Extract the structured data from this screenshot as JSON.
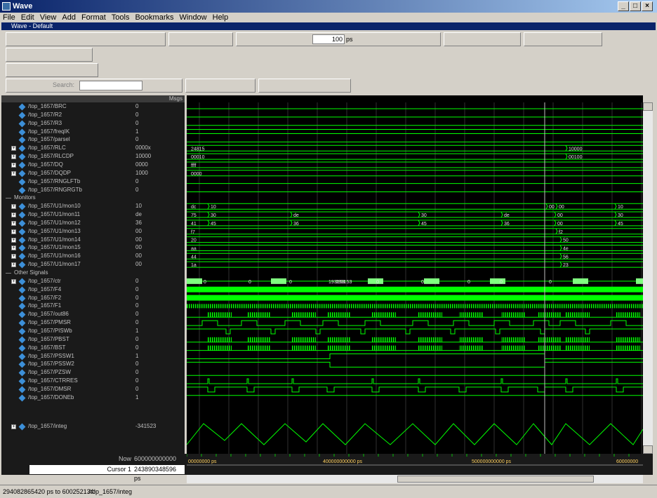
{
  "window": {
    "title": "Wave",
    "subtitle": "Wave - Default"
  },
  "menu": [
    "File",
    "Edit",
    "View",
    "Add",
    "Format",
    "Tools",
    "Bookmarks",
    "Window",
    "Help"
  ],
  "toolbar": {
    "time_value": "100",
    "time_unit": "ps",
    "search_placeholder": "Search:"
  },
  "columns": {
    "names_header": "",
    "values_header": "Msgs"
  },
  "signals": [
    {
      "name": "/top_1657/BRC",
      "value": "0",
      "expand": false
    },
    {
      "name": "/top_1657/R2",
      "value": "0",
      "expand": false
    },
    {
      "name": "/top_1657/R3",
      "value": "0",
      "expand": false
    },
    {
      "name": "/top_1657/freqIK",
      "value": "1",
      "expand": false
    },
    {
      "name": "/top_1657/parsel",
      "value": "0",
      "expand": false
    },
    {
      "name": "/top_1657/RLC",
      "value": "0000x",
      "expand": true
    },
    {
      "name": "/top_1657/RLCDP",
      "value": "10000",
      "expand": true
    },
    {
      "name": "/top_1657/DQ",
      "value": "0000",
      "expand": true
    },
    {
      "name": "/top_1657/DQDP",
      "value": "1000",
      "expand": true
    },
    {
      "name": "/top_1657/RNGLFTb",
      "value": "0",
      "expand": false
    },
    {
      "name": "/top_1657/RNGRGTb",
      "value": "0",
      "expand": false
    },
    {
      "name": "Monitors",
      "value": "",
      "divider": true
    },
    {
      "name": "/top_1657/U1/mon10",
      "value": "10",
      "expand": true
    },
    {
      "name": "/top_1657/U1/mon11",
      "value": "de",
      "expand": true
    },
    {
      "name": "/top_1657/U1/mon12",
      "value": "36",
      "expand": true
    },
    {
      "name": "/top_1657/U1/mon13",
      "value": "00",
      "expand": true
    },
    {
      "name": "/top_1657/U1/mon14",
      "value": "00",
      "expand": true
    },
    {
      "name": "/top_1657/U1/mon15",
      "value": "00",
      "expand": true
    },
    {
      "name": "/top_1657/U1/mon16",
      "value": "00",
      "expand": true
    },
    {
      "name": "/top_1657/U1/mon17",
      "value": "00",
      "expand": true
    },
    {
      "name": "Other Signals",
      "value": "",
      "divider": true
    },
    {
      "name": "/top_1657/ctr",
      "value": "0",
      "expand": true
    },
    {
      "name": "/top_1657/F4",
      "value": "0",
      "expand": false
    },
    {
      "name": "/top_1657/F2",
      "value": "0",
      "expand": false
    },
    {
      "name": "/top_1657/F1",
      "value": "0",
      "expand": false
    },
    {
      "name": "/top_1657/out86",
      "value": "0",
      "expand": false
    },
    {
      "name": "/top_1657/PMSR",
      "value": "0",
      "expand": false
    },
    {
      "name": "/top_1657/PISWb",
      "value": "1",
      "expand": false
    },
    {
      "name": "/top_1657/PBST",
      "value": "0",
      "expand": false
    },
    {
      "name": "/top_1657/BST",
      "value": "0",
      "expand": false
    },
    {
      "name": "/top_1657/PSSW1",
      "value": "1",
      "expand": false
    },
    {
      "name": "/top_1657/PSSW2",
      "value": "0",
      "expand": false
    },
    {
      "name": "/top_1657/PZSW",
      "value": "0",
      "expand": false
    },
    {
      "name": "/top_1657/CTRRES",
      "value": "0",
      "expand": false
    },
    {
      "name": "/top_1657/DMSR",
      "value": "0",
      "expand": false
    },
    {
      "name": "/top_1657/DONEb",
      "value": "1",
      "expand": false
    }
  ],
  "integ": {
    "name": "/top_1657/integ",
    "value": "-341523"
  },
  "bus_labels": {
    "rlc": [
      "24815",
      "10000"
    ],
    "rlcdp": [
      "00010",
      "00100"
    ],
    "dq": [
      "ffff"
    ],
    "dqdp": [
      "0000"
    ],
    "mon10": [
      "dc",
      "10",
      "00",
      "00",
      "10"
    ],
    "mon11": [
      "75",
      "30",
      "de",
      "30",
      "de",
      "00",
      "30"
    ],
    "mon12": [
      "41",
      "45",
      "36",
      "45",
      "36",
      "00",
      "45"
    ],
    "mon13": [
      "f7",
      "f2"
    ],
    "mon14": [
      "20",
      "50"
    ],
    "mon15": [
      "aa",
      "4e"
    ],
    "mon16": [
      "44",
      "56"
    ],
    "mon17": [
      "1a",
      "23"
    ],
    "ctr": [
      "0",
      "0",
      "0",
      "193153",
      "0",
      "0",
      "0",
      "0",
      "0",
      "0"
    ]
  },
  "bottom": {
    "now_label": "Now",
    "now_value": "600000000000 ps",
    "cursor_label": "Cursor 1",
    "cursor_value": "243890348596 ps",
    "ticks": [
      "00000000 ps",
      "400000000000 ps",
      "500000000000 ps",
      "60000000"
    ]
  },
  "status": {
    "range": "294082865420 ps to 600252134!",
    "selected": "/top_1657/integ"
  },
  "colors": {
    "wave": "#00ff00",
    "background": "#000000",
    "panel": "#1a1a1a"
  }
}
